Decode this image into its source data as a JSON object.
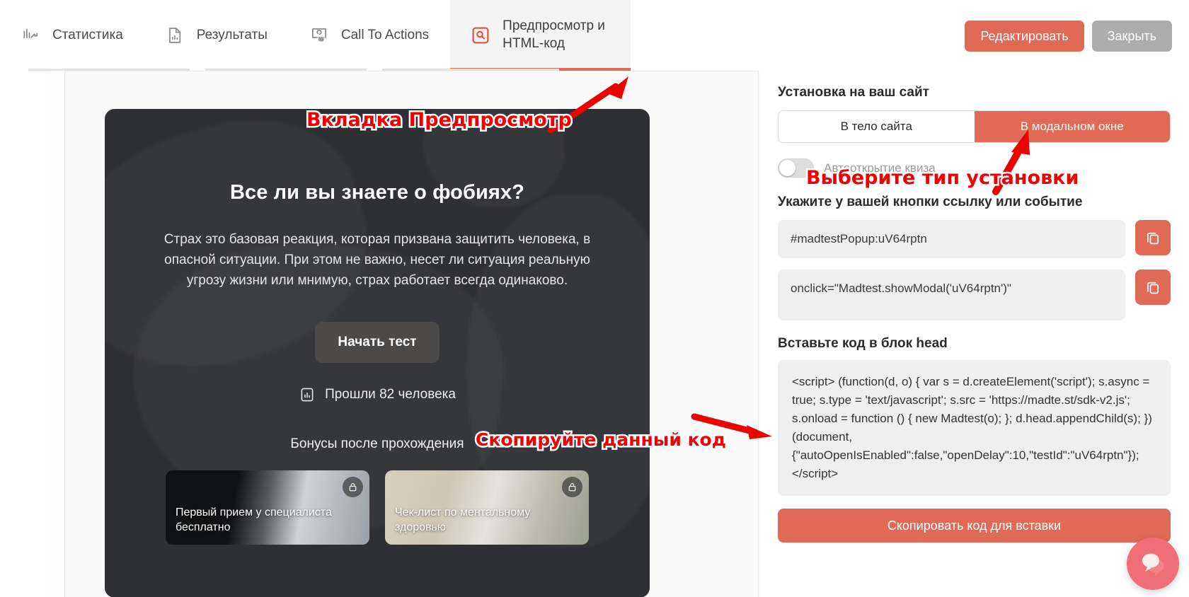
{
  "tabs": [
    {
      "id": "statistics",
      "label": "Статистика",
      "icon": "chart-line-icon",
      "active": false
    },
    {
      "id": "results",
      "label": "Результаты",
      "icon": "document-chart-icon",
      "active": false
    },
    {
      "id": "cta",
      "label": "Call To Actions",
      "icon": "click-pointer-icon",
      "active": false
    },
    {
      "id": "preview",
      "label": "Предпросмотр и\nHTML-код",
      "icon": "preview-search-icon",
      "active": true
    }
  ],
  "header": {
    "edit_label": "Редактировать",
    "close_label": "Закрыть"
  },
  "quiz": {
    "title": "Все ли вы знаете о фобиях?",
    "description": "Страх это базовая реакция, которая призвана защитить человека, в опасной ситуации. При этом не важно, несет ли ситуация реальную угрозу жизни или мнимую, страх работает всегда одинаково.",
    "start_label": "Начать тест",
    "passed_text": "Прошли 82 человека",
    "passed_count": 82,
    "passed_icon": "bar-chart-icon",
    "bonus_title": "Бонусы после прохождения",
    "bonuses": [
      {
        "caption": "Первый прием у специалиста бесплатно",
        "locked": true,
        "lock_icon": "lock-icon"
      },
      {
        "caption": "Чек-лист по ментальному здоровью",
        "locked": true,
        "lock_icon": "lock-icon"
      }
    ]
  },
  "settings": {
    "install_title": "Установка на ваш сайт",
    "segments": [
      {
        "label": "В тело сайта",
        "selected": false
      },
      {
        "label": "В модальном окне",
        "selected": true
      }
    ],
    "autoopen_label": "Автооткрытие квиза",
    "autoopen_on": false,
    "link_title": "Укажите у вашей кнопки ссылку или событие",
    "anchor_value": "#madtestPopup:uV64rptn",
    "onclick_value": "onclick=\"Madtest.showModal('uV64rptn')\"",
    "copy_icon": "copy-icon",
    "head_title": "Вставьте код в блок head",
    "head_code": "<script> (function(d, o) { var s = d.createElement('script'); s.async = true; s.type = 'text/javascript'; s.src = 'https://madte.st/sdk-v2.js'; s.onload = function () { new Madtest(o); }; d.head.appendChild(s); }) (document, {\"autoOpenIsEnabled\":false,\"openDelay\":10,\"testId\":\"uV64rptn\"}); </script>",
    "copy_all_label": "Скопировать код для вставки"
  },
  "annotations": [
    {
      "id": "tab-note",
      "text": "Вкладка Предпросмотр"
    },
    {
      "id": "install-note",
      "text": "Выберите тип установки"
    },
    {
      "id": "code-note",
      "text": "Скопируйте данный код"
    }
  ],
  "chat": {
    "icon": "chat-bubble-icon"
  },
  "colors": {
    "accent": "#e06a56",
    "annotation_red": "#f00000",
    "grey_button": "#adadad",
    "quiz_bg": "#2f3033",
    "chat_bg": "#ef6e77"
  }
}
